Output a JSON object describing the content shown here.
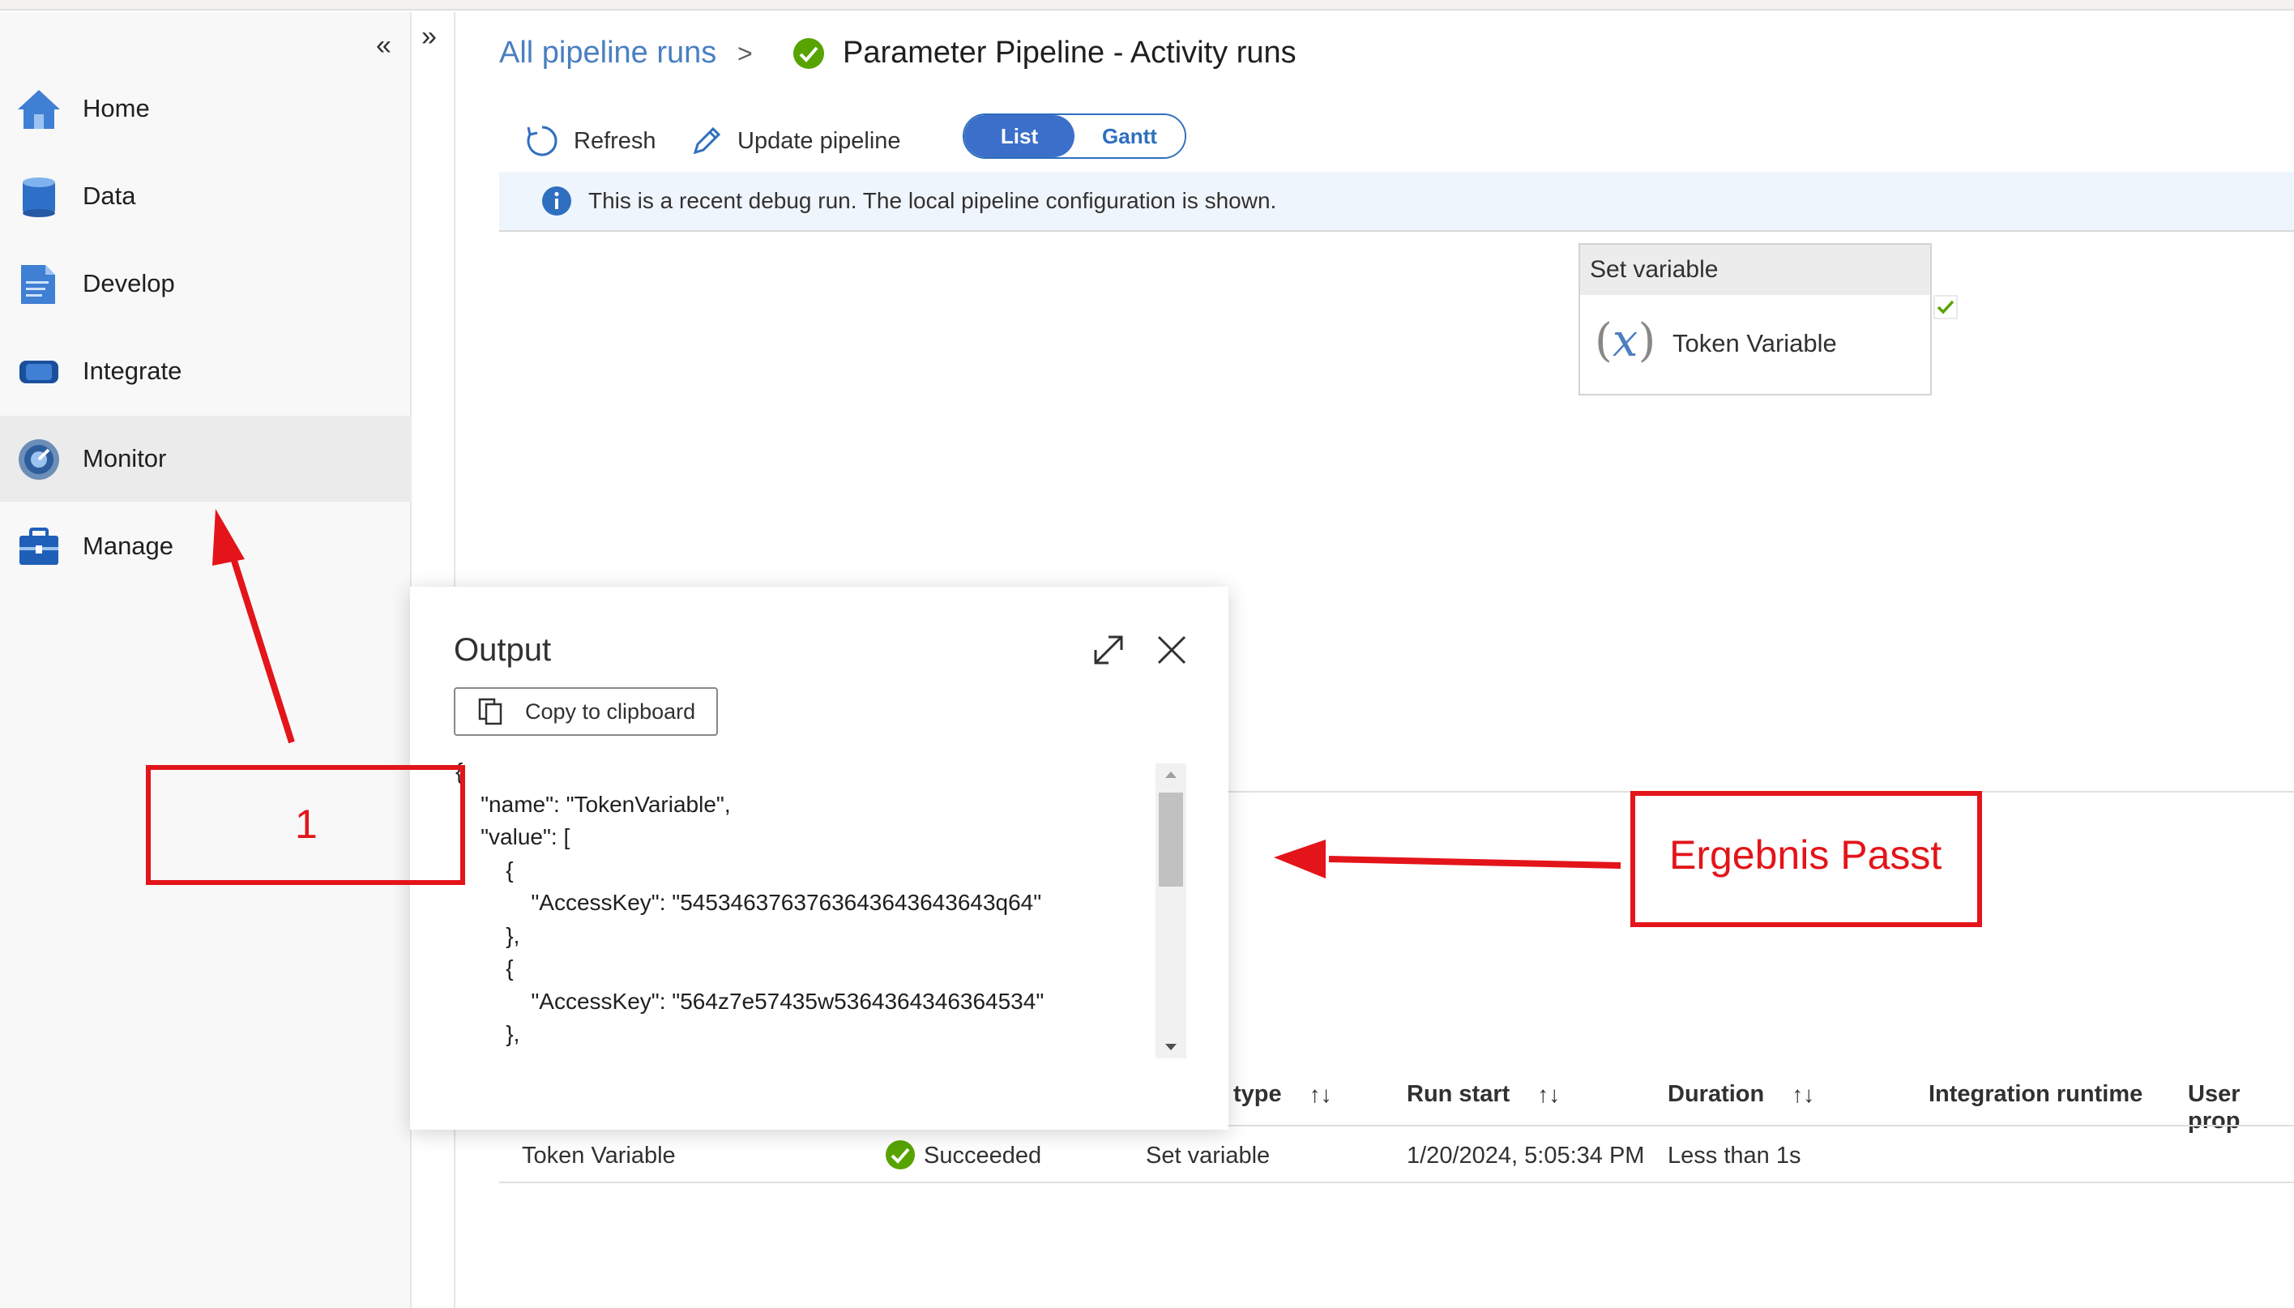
{
  "sidebar": {
    "collapse_glyph": "«",
    "items": [
      {
        "label": "Home",
        "icon": "home-icon"
      },
      {
        "label": "Data",
        "icon": "database-icon"
      },
      {
        "label": "Develop",
        "icon": "develop-icon"
      },
      {
        "label": "Integrate",
        "icon": "integrate-icon"
      },
      {
        "label": "Monitor",
        "icon": "monitor-icon",
        "active": true
      },
      {
        "label": "Manage",
        "icon": "manage-icon"
      }
    ]
  },
  "expand_glyph": "»",
  "header": {
    "breadcrumb_link": "All pipeline runs",
    "breadcrumb_sep": ">",
    "title": "Parameter Pipeline - Activity runs"
  },
  "toolbar": {
    "refresh": "Refresh",
    "update": "Update pipeline",
    "view_list": "List",
    "view_gantt": "Gantt"
  },
  "info": {
    "message": "This is a recent debug run. The local pipeline configuration is shown."
  },
  "activity_card": {
    "type": "Set variable",
    "name": "Token Variable"
  },
  "table": {
    "headers": [
      "type",
      "Run start",
      "Duration",
      "Integration runtime",
      "User prop"
    ],
    "sort_glyph": "↑↓",
    "row": {
      "name": "Token Variable",
      "status": "Succeeded",
      "type": "Set variable",
      "run_start": "1/20/2024, 5:05:34 PM",
      "duration": "Less than 1s"
    }
  },
  "output_panel": {
    "title": "Output",
    "copy_label": "Copy to clipboard",
    "code_lines": [
      "{",
      "    \"name\": \"TokenVariable\",",
      "    \"value\": [",
      "        {",
      "            \"AccessKey\": \"5453463763763643643643643q64\"",
      "        },",
      "        {",
      "            \"AccessKey\": \"564z7e57435w5364364346364534\"",
      "        },"
    ]
  },
  "annotations": {
    "box1_label": "1",
    "box2_label": "Ergebnis Passt",
    "color": "#e3151a"
  },
  "colors": {
    "accent": "#3b6fc9",
    "link": "#4a7fc1",
    "success": "#57a300"
  }
}
